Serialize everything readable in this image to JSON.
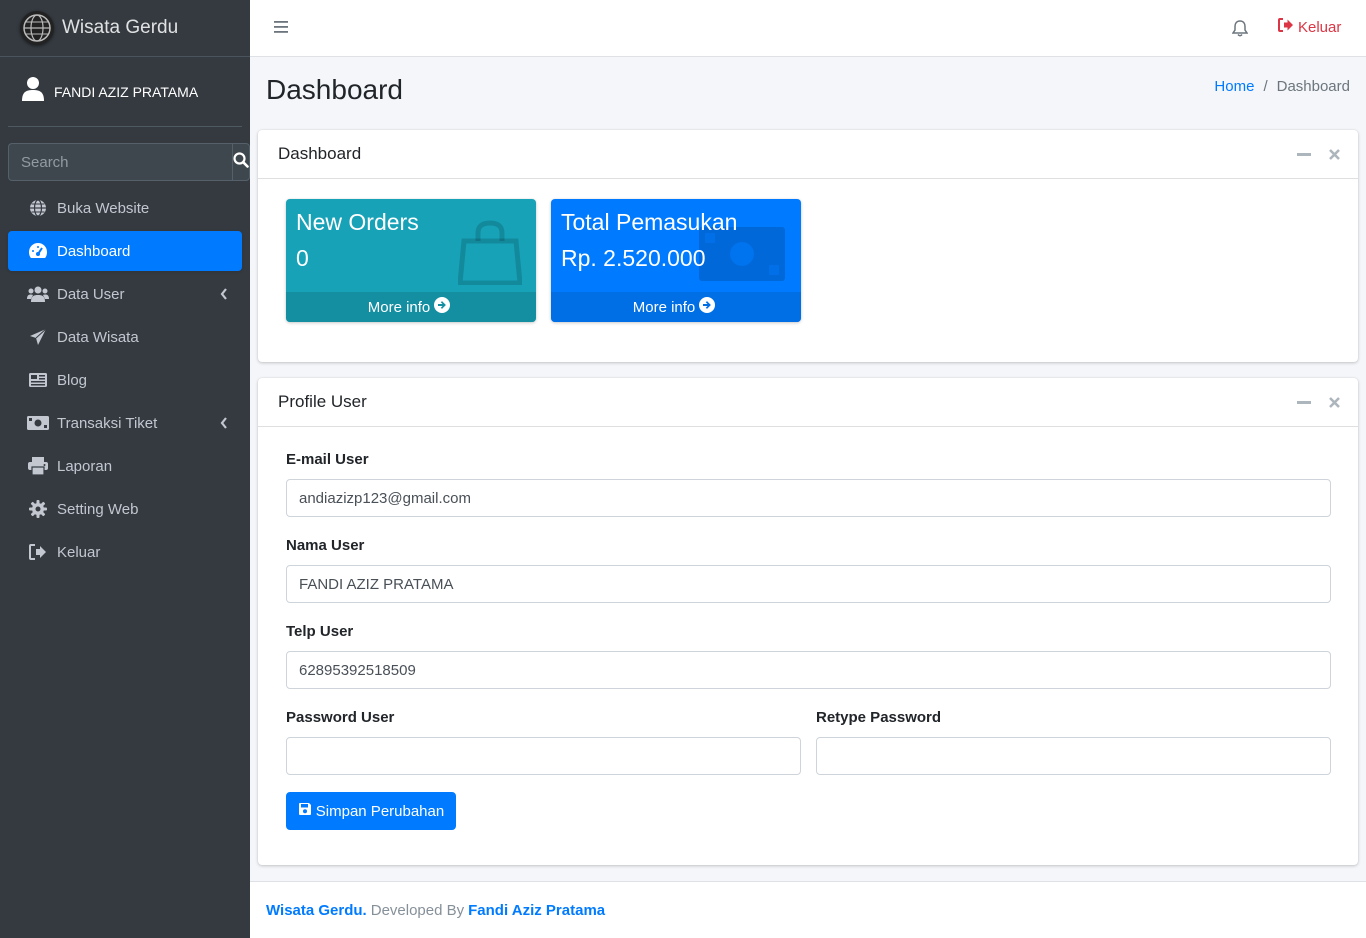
{
  "brand": {
    "name": "Wisata Gerdu",
    "logo_icon": "globe-logo-icon"
  },
  "user_panel": {
    "name": "FANDI AZIZ PRATAMA",
    "icon": "user-icon"
  },
  "sidebar_search": {
    "placeholder": "Search"
  },
  "nav": {
    "items": [
      {
        "label": "Buka Website",
        "icon": "globe-icon"
      },
      {
        "label": "Dashboard",
        "icon": "tachometer-icon",
        "active": true
      },
      {
        "label": "Data User",
        "icon": "users-icon",
        "has_children": true
      },
      {
        "label": "Data Wisata",
        "icon": "paper-plane-icon"
      },
      {
        "label": "Blog",
        "icon": "newspaper-icon"
      },
      {
        "label": "Transaksi Tiket",
        "icon": "money-bill-icon",
        "has_children": true
      },
      {
        "label": "Laporan",
        "icon": "print-icon"
      },
      {
        "label": "Setting Web",
        "icon": "cog-icon"
      },
      {
        "label": "Keluar",
        "icon": "sign-out-icon"
      }
    ]
  },
  "topbar": {
    "logout_label": "Keluar"
  },
  "page": {
    "title": "Dashboard",
    "breadcrumb": {
      "home": "Home",
      "separator": "/",
      "current": "Dashboard"
    }
  },
  "dashboard_card": {
    "title": "Dashboard",
    "boxes": [
      {
        "title": "New Orders",
        "value": "0",
        "link": "More info",
        "color": "#17a2b8",
        "icon": "shopping-bag-icon"
      },
      {
        "title": "Total Pemasukan",
        "value": "Rp. 2.520.000",
        "link": "More info",
        "color": "#007bff",
        "icon": "money-bill-icon"
      }
    ]
  },
  "profile_card": {
    "title": "Profile User",
    "fields": {
      "email": {
        "label": "E-mail User",
        "value": "andiazizp123@gmail.com"
      },
      "name": {
        "label": "Nama User",
        "value": "FANDI AZIZ PRATAMA"
      },
      "phone": {
        "label": "Telp User",
        "value": "62895392518509"
      },
      "password": {
        "label": "Password User",
        "value": ""
      },
      "retype": {
        "label": "Retype Password",
        "value": ""
      }
    },
    "save_label": "Simpan Perubahan"
  },
  "footer": {
    "brand": "Wisata Gerdu.",
    "middle": "Developed By",
    "author": "Fandi Aziz Pratama"
  },
  "colors": {
    "primary": "#007bff",
    "info": "#17a2b8",
    "danger": "#dc3545",
    "sidebar": "#343a40"
  }
}
